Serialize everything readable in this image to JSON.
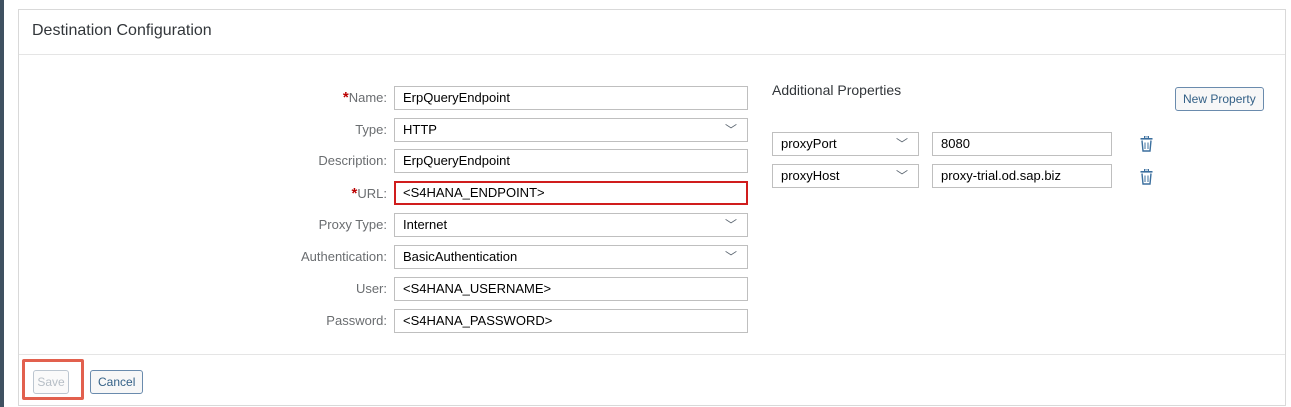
{
  "panel": {
    "title": "Destination Configuration"
  },
  "form": {
    "name": {
      "label": "Name:",
      "value": "ErpQueryEndpoint"
    },
    "type": {
      "label": "Type:",
      "value": "HTTP"
    },
    "description": {
      "label": "Description:",
      "value": "ErpQueryEndpoint"
    },
    "url": {
      "label": "URL:",
      "value": "<S4HANA_ENDPOINT>"
    },
    "proxy_type": {
      "label": "Proxy Type:",
      "value": "Internet"
    },
    "authentication": {
      "label": "Authentication:",
      "value": "BasicAuthentication"
    },
    "user": {
      "label": "User:",
      "value": "<S4HANA_USERNAME>"
    },
    "password": {
      "label": "Password:",
      "value": "<S4HANA_PASSWORD>"
    },
    "required_marker": "*"
  },
  "additional": {
    "title": "Additional Properties",
    "new_property_label": "New Property",
    "properties": [
      {
        "key": "proxyPort",
        "value": "8080"
      },
      {
        "key": "proxyHost",
        "value": "proxy-trial.od.sap.biz"
      }
    ]
  },
  "footer": {
    "save_label": "Save",
    "cancel_label": "Cancel"
  },
  "icons": {
    "dropdown": "chevron-down-icon",
    "delete": "trash-icon"
  },
  "colors": {
    "error_border": "#d01d1d",
    "required": "#bb0000",
    "highlight": "#e2604e",
    "button_text": "#346187"
  }
}
